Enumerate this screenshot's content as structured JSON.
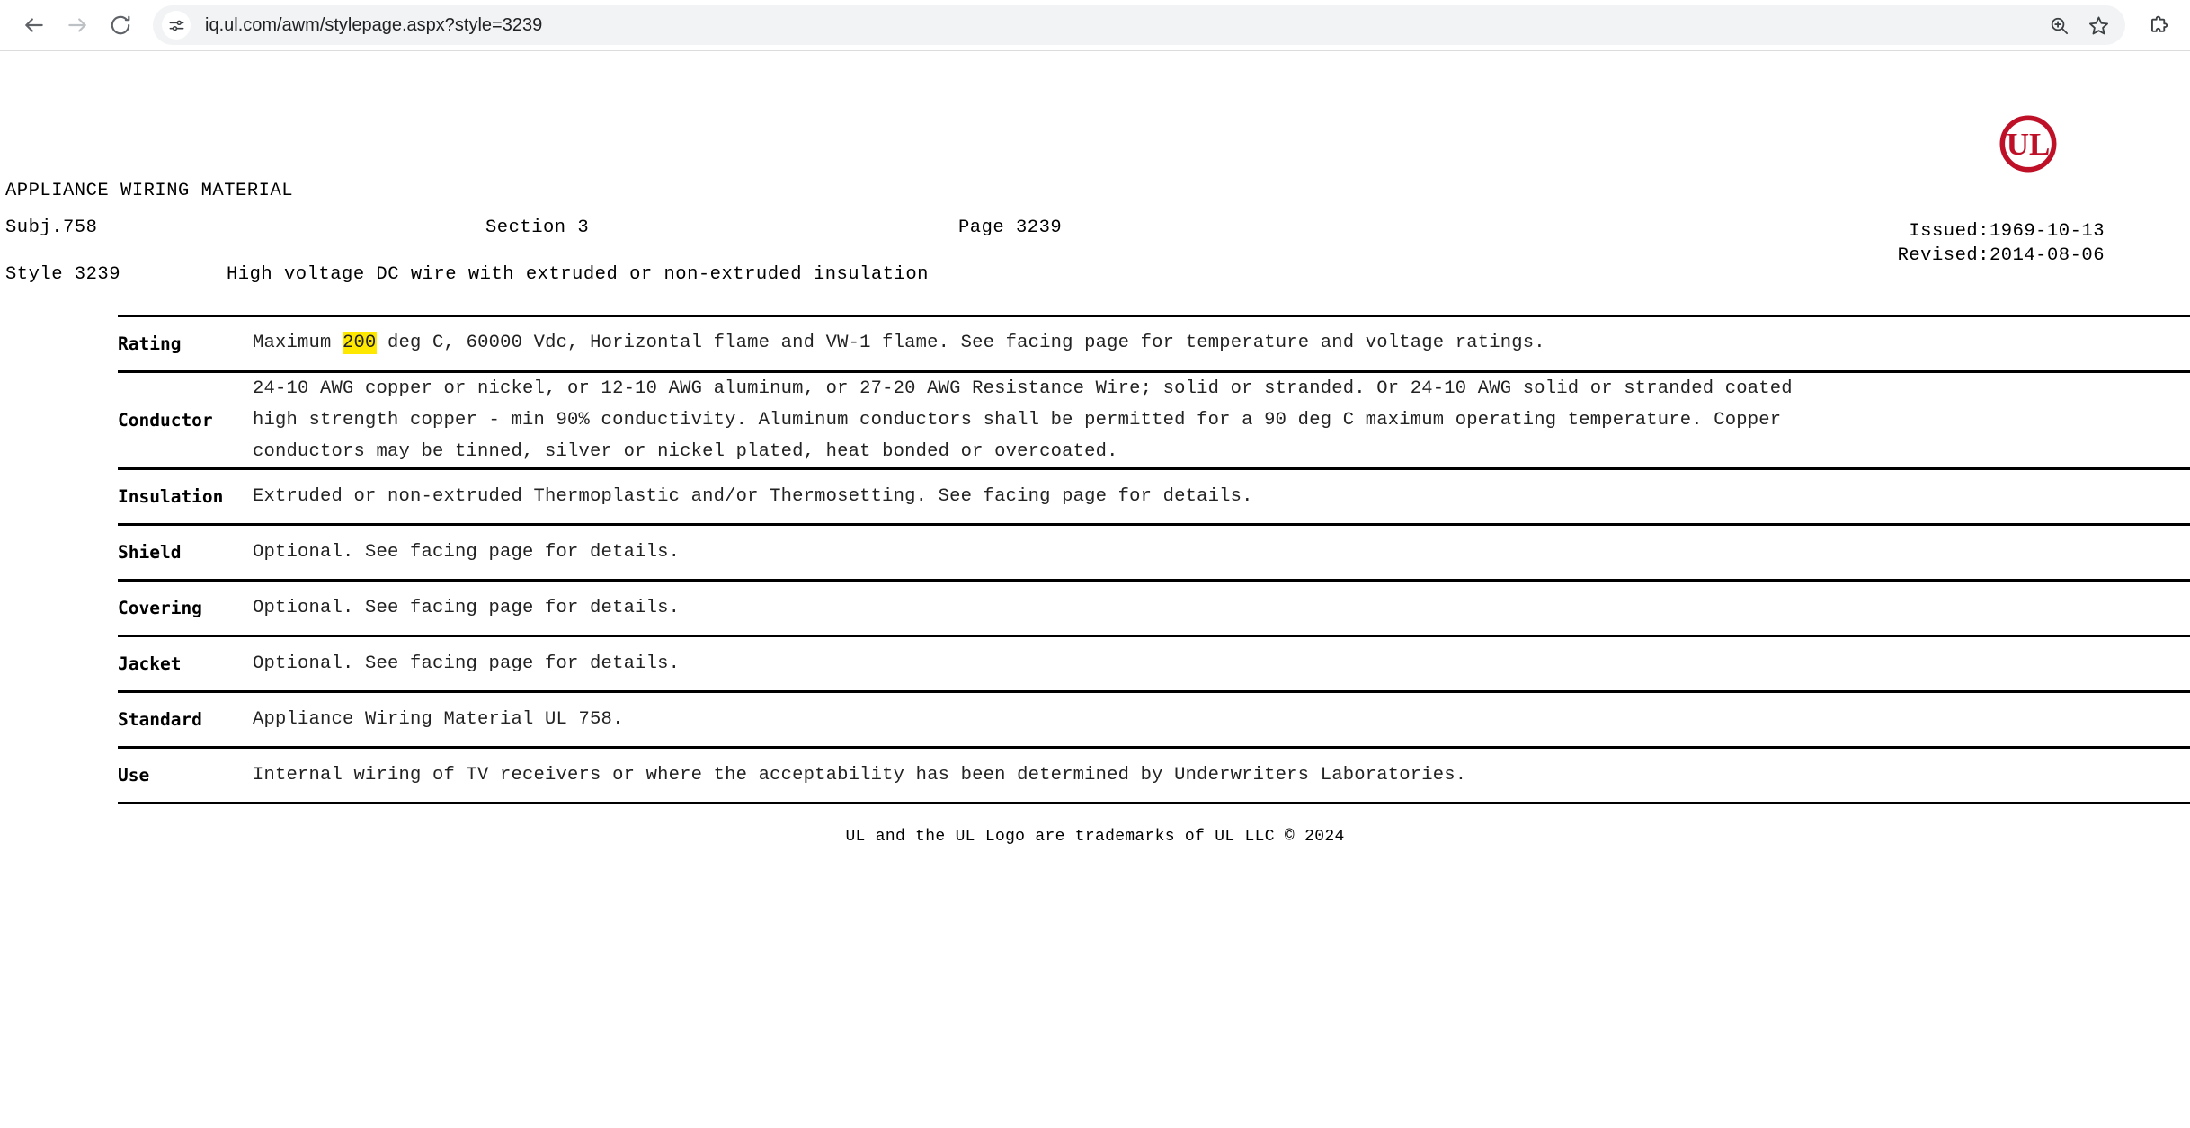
{
  "browser": {
    "back_label": "Back",
    "forward_label": "Forward",
    "reload_label": "Reload",
    "site_settings_label": "View site information",
    "url": "iq.ul.com/awm/stylepage.aspx?style=3239",
    "zoom_label": "Zoom",
    "bookmark_label": "Bookmark this tab",
    "extensions_label": "Extensions"
  },
  "document": {
    "title": "APPLIANCE WIRING MATERIAL",
    "subject": "Subj.758",
    "section": "Section 3",
    "page": "Page 3239",
    "issued": "Issued:1969-10-13",
    "revised": "Revised:2014-08-06",
    "style_label": "Style 3239",
    "style_description": "High voltage DC wire with extruded or non-extruded insulation",
    "rows": [
      {
        "label": "Rating",
        "lines": [
          "Maximum 200 deg C, 60000 Vdc, Horizontal flame and VW-1 flame. See facing page for temperature and voltage ratings."
        ],
        "highlight": "200",
        "rating_prefix": "Maximum ",
        "rating_suffix": " deg C, 60000 Vdc, Horizontal flame and VW-1 flame. See facing page for temperature and voltage ratings."
      },
      {
        "label": "Conductor",
        "lines": [
          "24-10 AWG copper or nickel, or 12-10 AWG aluminum, or 27-20 AWG Resistance Wire; solid or stranded. Or 24-10 AWG solid or stranded coated",
          "high strength copper - min 90% conductivity. Aluminum conductors shall be permitted for a 90 deg C maximum operating temperature. Copper",
          "conductors may be tinned, silver or nickel plated, heat bonded or overcoated."
        ]
      },
      {
        "label": "Insulation",
        "lines": [
          "Extruded or non-extruded Thermoplastic and/or Thermosetting. See facing page for details."
        ]
      },
      {
        "label": "Shield",
        "lines": [
          "Optional. See facing page for details."
        ]
      },
      {
        "label": "Covering",
        "lines": [
          "Optional. See facing page for details."
        ]
      },
      {
        "label": "Jacket",
        "lines": [
          "Optional. See facing page for details."
        ]
      },
      {
        "label": "Standard",
        "lines": [
          "Appliance Wiring Material UL 758."
        ]
      },
      {
        "label": "Use",
        "lines": [
          "Internal wiring of TV receivers or where the acceptability has been determined by Underwriters Laboratories."
        ]
      }
    ],
    "footer": "UL and the UL Logo are trademarks of UL LLC © 2024",
    "logo_text": "UL"
  },
  "colors": {
    "ul_red": "#BE1128",
    "highlight_yellow": "#FFE800",
    "omnibox_bg": "#F1F3F4"
  }
}
